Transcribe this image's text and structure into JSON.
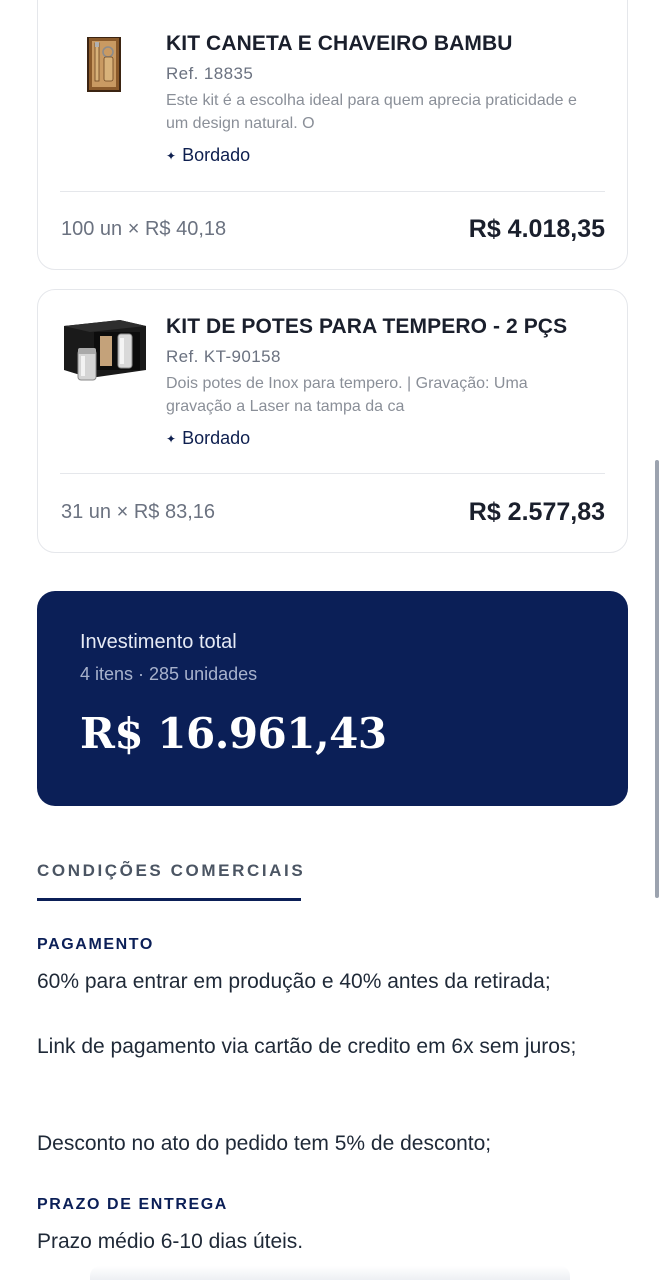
{
  "items": [
    {
      "name": "KIT CANETA E CHAVEIRO BAMBU",
      "ref": "Ref. 18835",
      "description": "Este kit é a escolha ideal para quem aprecia praticidade e um design natural. O",
      "tag_icon": "sparkle-icon",
      "tag": "Bordado",
      "qty_price": "100 un × R$ 40,18",
      "total": "R$ 4.018,35"
    },
    {
      "name": "KIT DE POTES PARA TEMPERO - 2 PÇS",
      "ref": "Ref. KT-90158",
      "description": "Dois potes de Inox para tempero. | Gravação: Uma gravação a Laser na tampa da ca",
      "tag_icon": "sparkle-icon",
      "tag": "Bordado",
      "qty_price": "31 un × R$ 83,16",
      "total": "R$ 2.577,83"
    }
  ],
  "investment": {
    "label": "Investimento total",
    "summary": "4 itens · 285 unidades",
    "amount": "R$ 16.961,43"
  },
  "conditions": {
    "title": "CONDIÇÕES COMERCIAIS",
    "payment_heading": "PAGAMENTO",
    "payment_lines": [
      "60% para entrar em produção e 40% antes da retirada;",
      "Link de pagamento via cartão de credito em 6x sem juros;",
      "Desconto no ato do pedido tem 5% de desconto;"
    ],
    "delivery_heading": "PRAZO DE ENTREGA",
    "delivery_text": "Prazo médio 6-10 dias úteis."
  },
  "colors": {
    "brand_navy": "#0b1f57",
    "card_border": "#e5e7eb",
    "muted_text": "#6b7280"
  }
}
